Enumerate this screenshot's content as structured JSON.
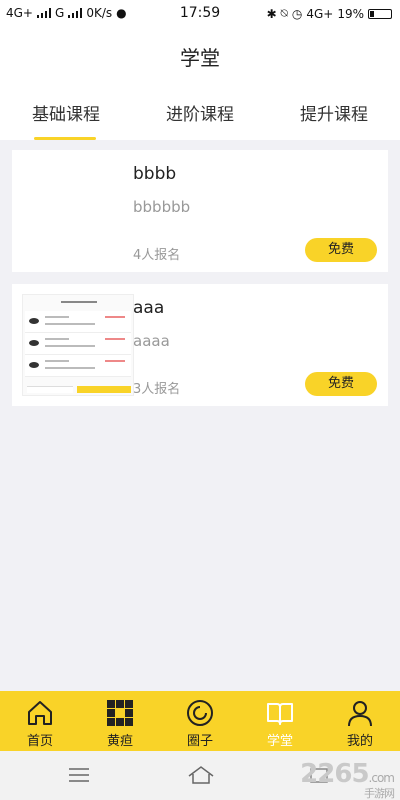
{
  "status": {
    "network1": "4G+",
    "network2": "G",
    "speed": "0K/s",
    "time": "17:59",
    "network3": "4G+",
    "battery": "19%"
  },
  "header": {
    "title": "学堂"
  },
  "tabs": [
    {
      "label": "基础课程",
      "active": true
    },
    {
      "label": "进阶课程",
      "active": false
    },
    {
      "label": "提升课程",
      "active": false
    }
  ],
  "courses": [
    {
      "title": "bbbb",
      "desc": "bbbbbb",
      "count": "4人报名",
      "button": "免费"
    },
    {
      "title": "aaa",
      "desc": "aaaa",
      "count": "3人报名",
      "button": "免费"
    }
  ],
  "bottom_nav": [
    {
      "label": "首页",
      "icon": "home-icon"
    },
    {
      "label": "黄疸",
      "icon": "qr-grid-icon"
    },
    {
      "label": "圈子",
      "icon": "circle-icon"
    },
    {
      "label": "学堂",
      "icon": "book-icon",
      "active": true
    },
    {
      "label": "我的",
      "icon": "person-icon"
    }
  ],
  "watermark": {
    "text": "2265",
    "suffix": ".com",
    "sub": "手游网"
  },
  "colors": {
    "accent": "#f9d328",
    "background": "#f1f1f5"
  }
}
